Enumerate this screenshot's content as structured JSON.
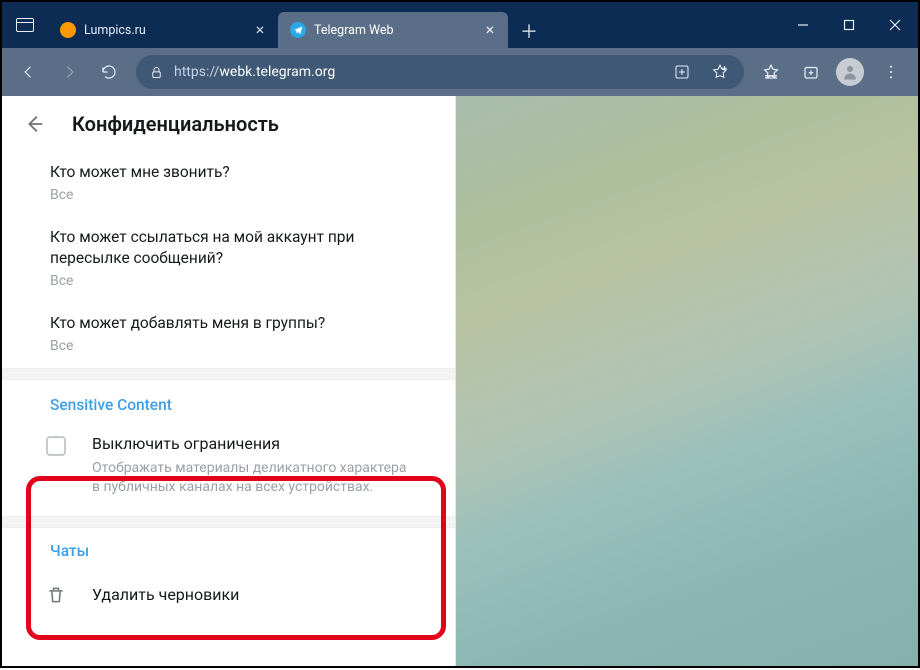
{
  "tabs": [
    {
      "title": "Lumpics.ru",
      "favicon": "orange-circle"
    },
    {
      "title": "Telegram Web",
      "favicon": "telegram"
    }
  ],
  "address": {
    "protocol": "https://",
    "host": "webk.telegram.org",
    "path": ""
  },
  "settings": {
    "header": "Конфиденциальность",
    "rows": [
      {
        "q": "Кто может мне звонить?",
        "a": "Все"
      },
      {
        "q": "Кто может ссылаться на мой аккаунт при пересылке сообщений?",
        "a": "Все"
      },
      {
        "q": "Кто может добавлять меня в группы?",
        "a": "Все"
      }
    ],
    "sensitive": {
      "section": "Sensitive Content",
      "label": "Выключить ограничения",
      "desc": "Отображать материалы деликатного характера в публичных каналах на всех устройствах."
    },
    "chats_section": "Чаты",
    "delete_drafts": "Удалить черновики"
  }
}
